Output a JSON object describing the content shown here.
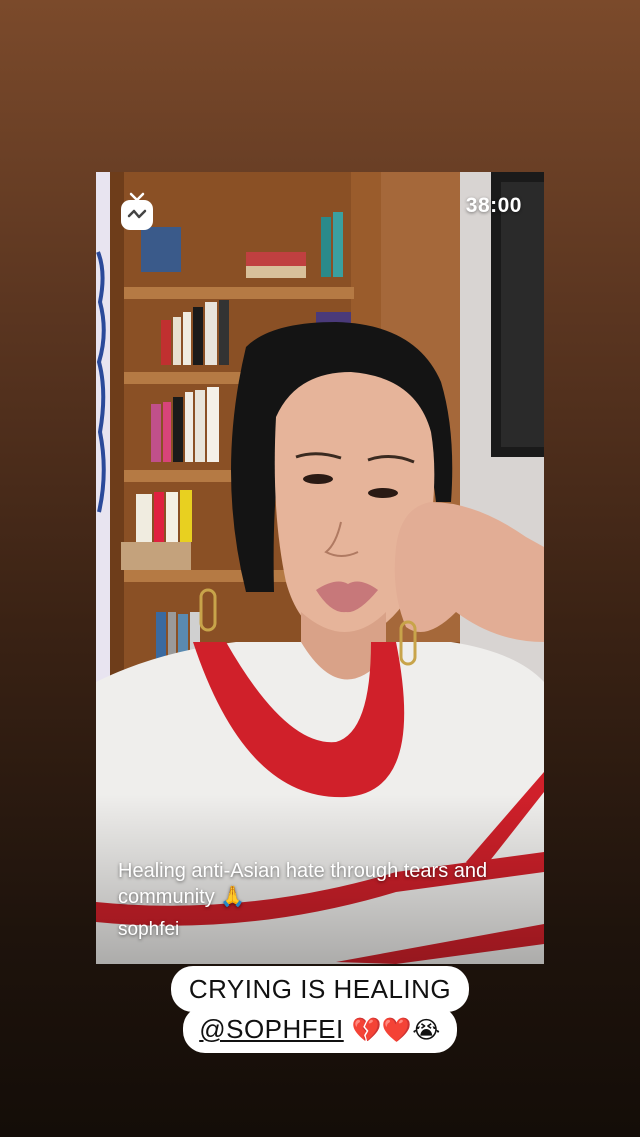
{
  "story": {
    "video_title": "Healing anti-Asian hate through tears and community 🙏",
    "username": "sophfei",
    "duration": "38:00",
    "app_icon": "igtv-icon"
  },
  "caption": {
    "line1": "CRYING IS HEALING",
    "mention": "@SOPHFEI",
    "emojis": "💔❤️😭"
  },
  "colors": {
    "background_top": "#7b4a2b",
    "background_bottom": "#140d08",
    "caption_bg": "#ffffff",
    "sweater_stripe": "#d0202a"
  }
}
